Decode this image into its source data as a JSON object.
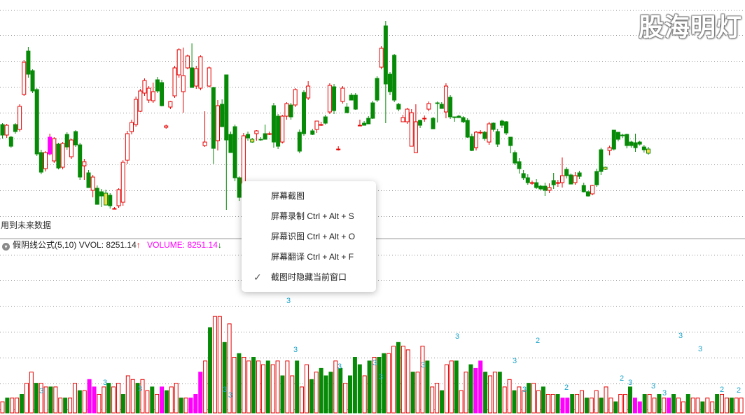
{
  "watermark": "股海明灯",
  "note": "用到未来数据",
  "indicator": {
    "title": "假阴线公式(5,10)",
    "vvol_label": "VVOL: ",
    "vvol_value": "8251.14",
    "vvol_arrow": "↑",
    "volume_label": "VOLUME: ",
    "volume_value": "8251.14",
    "volume_arrow": "↓"
  },
  "context_menu": {
    "items": [
      {
        "label": "屏幕截图",
        "checked": false
      },
      {
        "label": "屏幕录制 Ctrl + Alt + S",
        "checked": false
      },
      {
        "label": "屏幕识图 Ctrl + Alt + O",
        "checked": false
      },
      {
        "label": "屏幕翻译 Ctrl + Alt + F",
        "checked": false
      },
      {
        "label": "截图时隐藏当前窗口",
        "checked": true
      }
    ],
    "check_glyph": "✓"
  },
  "colors": {
    "rise": "#e60000",
    "fall": "#078a07",
    "special": "#ff00ff",
    "highlight": "#ffd54a",
    "volume_peak": "#ff0000",
    "grid": "#8a8a8a",
    "count_text": "#1aa3c9"
  },
  "chart_data": {
    "type": "candlestick-with-volume",
    "price_candles_ohlc": [
      [
        131,
        116,
        111,
        133
      ],
      [
        116,
        130,
        112,
        132
      ],
      [
        113,
        100,
        98,
        115
      ],
      [
        131,
        121,
        118,
        133
      ],
      [
        124,
        157,
        121,
        160
      ],
      [
        174,
        220,
        172,
        223
      ],
      [
        236,
        203,
        198,
        242
      ],
      [
        208,
        179,
        176,
        210
      ],
      [
        181,
        89,
        86,
        183
      ],
      [
        91,
        63,
        60,
        95
      ],
      [
        68,
        91,
        64,
        93
      ],
      [
        89,
        113,
        87,
        118
      ],
      [
        79,
        111,
        76,
        113
      ],
      [
        103,
        69,
        67,
        105
      ],
      [
        70,
        104,
        67,
        106
      ],
      [
        117,
        99,
        95,
        120
      ],
      [
        85,
        109,
        82,
        111
      ],
      [
        121,
        102,
        99,
        123
      ],
      [
        102,
        56,
        52,
        105
      ],
      [
        72,
        78,
        52,
        82
      ],
      [
        62,
        41,
        59,
        66
      ],
      [
        37,
        56,
        27,
        59
      ],
      [
        40,
        17,
        37,
        44
      ],
      [
        35,
        29,
        13,
        39
      ],
      [
        33,
        16,
        28,
        38
      ],
      [
        30,
        15,
        11,
        33
      ],
      [
        11,
        11,
        10,
        13
      ],
      [
        15,
        38,
        12,
        40
      ],
      [
        20,
        77,
        15,
        80
      ],
      [
        80,
        118,
        75,
        122
      ],
      [
        121,
        134,
        117,
        138
      ],
      [
        131,
        167,
        128,
        171
      ],
      [
        150,
        179,
        149,
        182
      ],
      [
        176,
        194,
        172,
        197
      ],
      [
        166,
        183,
        162,
        186
      ],
      [
        165,
        178,
        162,
        191
      ],
      [
        195,
        179,
        176,
        199
      ],
      [
        191,
        158,
        157,
        195
      ],
      [
        127,
        129,
        125,
        131
      ],
      [
        156,
        164,
        153,
        165
      ],
      [
        172,
        212,
        169,
        215
      ],
      [
        202,
        238,
        198,
        240
      ],
      [
        178,
        201,
        148,
        241
      ],
      [
        212,
        229,
        210,
        231
      ],
      [
        212,
        184,
        208,
        247
      ],
      [
        186,
        211,
        182,
        215
      ],
      [
        183,
        228,
        180,
        230
      ],
      [
        101,
        106,
        99,
        150
      ],
      [
        186,
        212,
        184,
        214
      ],
      [
        184,
        97,
        75,
        100
      ],
      [
        108,
        158,
        94,
        166
      ],
      [
        160,
        128,
        142,
        167
      ],
      [
        202,
        109,
        9,
        110
      ],
      [
        117,
        91,
        109,
        121
      ],
      [
        128,
        55,
        50,
        131
      ],
      [
        55,
        27,
        22,
        57
      ],
      [
        27,
        115,
        23,
        119
      ],
      [
        117,
        112,
        108,
        121
      ],
      [
        110,
        106,
        105,
        112
      ],
      [
        118,
        122,
        108,
        123
      ],
      [
        110,
        109,
        108,
        113
      ],
      [
        118,
        110,
        112,
        131
      ],
      [
        118,
        118,
        116,
        121
      ],
      [
        158,
        106,
        98,
        162
      ],
      [
        143,
        100,
        96,
        146
      ],
      [
        106,
        143,
        104,
        145
      ],
      [
        143,
        161,
        138,
        163
      ],
      [
        159,
        142,
        138,
        162
      ],
      [
        159,
        181,
        156,
        183
      ],
      [
        120,
        93,
        90,
        124
      ],
      [
        177,
        118,
        115,
        180
      ],
      [
        169,
        186,
        166,
        193
      ],
      [
        122,
        117,
        116,
        125
      ],
      [
        124,
        136,
        119,
        129
      ],
      [
        131,
        131,
        129,
        135
      ],
      [
        142,
        133,
        131,
        145
      ],
      [
        149,
        187,
        146,
        190
      ],
      [
        185,
        151,
        146,
        189
      ],
      [
        96,
        96,
        94,
        100
      ],
      [
        164,
        183,
        161,
        186
      ],
      [
        156,
        148,
        156,
        162
      ],
      [
        173,
        166,
        169,
        176
      ],
      [
        173,
        153,
        152,
        176
      ],
      [
        130,
        130,
        136,
        138
      ],
      [
        133,
        130,
        130,
        136
      ],
      [
        140,
        132,
        134,
        143
      ],
      [
        162,
        140,
        139,
        165
      ],
      [
        197,
        166,
        163,
        200
      ],
      [
        213,
        240,
        210,
        243
      ],
      [
        272,
        189,
        133,
        279
      ],
      [
        203,
        178,
        173,
        206
      ],
      [
        230,
        166,
        163,
        232
      ],
      [
        160,
        153,
        150,
        162
      ],
      [
        135,
        141,
        138,
        145
      ],
      [
        135,
        153,
        132,
        155
      ],
      [
        100,
        148,
        135,
        153
      ],
      [
        91,
        135,
        142,
        160
      ],
      [
        137,
        130,
        126,
        138
      ],
      [
        140,
        140,
        135,
        144
      ],
      [
        153,
        161,
        150,
        164
      ],
      [
        140,
        125,
        131,
        142
      ],
      [
        162,
        161,
        134,
        164
      ],
      [
        160,
        154,
        156,
        163
      ],
      [
        149,
        186,
        140,
        190
      ],
      [
        170,
        142,
        139,
        173
      ],
      [
        142,
        141,
        135,
        140
      ],
      [
        143,
        141,
        142,
        145
      ],
      [
        141,
        135,
        133,
        143
      ],
      [
        137,
        113,
        112,
        140
      ],
      [
        114,
        94,
        93,
        118
      ],
      [
        98,
        120,
        94,
        122
      ],
      [
        120,
        120,
        117,
        123
      ],
      [
        120,
        111,
        108,
        122
      ],
      [
        106,
        132,
        102,
        135
      ],
      [
        133,
        124,
        121,
        134
      ],
      [
        121,
        103,
        99,
        125
      ],
      [
        136,
        130,
        126,
        138
      ],
      [
        135,
        119,
        116,
        136
      ],
      [
        113,
        101,
        90,
        106
      ],
      [
        91,
        76,
        73,
        94
      ],
      [
        78,
        68,
        61,
        83
      ],
      [
        61,
        55,
        52,
        66
      ],
      [
        55,
        48,
        45,
        60
      ],
      [
        48,
        48,
        45,
        51
      ],
      [
        48,
        41,
        39,
        53
      ],
      [
        43,
        39,
        37,
        45
      ],
      [
        43,
        37,
        29,
        48
      ],
      [
        37,
        41,
        33,
        47
      ],
      [
        51,
        45,
        39,
        62
      ],
      [
        48,
        48,
        42,
        52
      ],
      [
        48,
        58,
        41,
        84
      ],
      [
        67,
        58,
        54,
        70
      ],
      [
        59,
        46,
        46,
        61
      ],
      [
        48,
        58,
        45,
        63
      ],
      [
        62,
        57,
        53,
        65
      ],
      [
        44,
        35,
        34,
        48
      ],
      [
        35,
        29,
        28,
        36
      ],
      [
        32,
        44,
        30,
        45
      ],
      [
        64,
        45,
        42,
        68
      ],
      [
        95,
        64,
        59,
        98
      ],
      [
        70,
        67,
        66,
        71
      ],
      [
        94,
        98,
        87,
        101
      ],
      [
        123,
        96,
        94,
        119
      ],
      [
        120,
        110,
        107,
        120
      ],
      [
        116,
        115,
        112,
        118
      ],
      [
        117,
        101,
        97,
        118
      ],
      [
        106,
        101,
        98,
        108
      ],
      [
        105,
        98,
        92,
        118
      ],
      [
        106,
        103,
        101,
        108
      ],
      [
        99,
        95,
        91,
        102
      ],
      [
        96,
        90,
        88,
        99
      ]
    ],
    "price_note": "OHLC values are in the chart's price units read from the gridlines (0 = lowest gridline); price axis labels are not visible in the screenshot.",
    "volume_bars": [
      3,
      4,
      4,
      4,
      5,
      8,
      11,
      8,
      8,
      7,
      7,
      7,
      4,
      4,
      4,
      8,
      6,
      6,
      9,
      7,
      5,
      7,
      8,
      7,
      8,
      5,
      10,
      9,
      8,
      9,
      6,
      7,
      5,
      7,
      6,
      7,
      8,
      4,
      4,
      4,
      5,
      11,
      14,
      23,
      26,
      26,
      19,
      24,
      15,
      16,
      15,
      14,
      15,
      14,
      13,
      14,
      13,
      14,
      10,
      14,
      10,
      14,
      7,
      13,
      9,
      11,
      12,
      10,
      11,
      14,
      12,
      8,
      10,
      15,
      13,
      10,
      14,
      15,
      15,
      16,
      16,
      18,
      19,
      18,
      17,
      11,
      11,
      18,
      14,
      7,
      8,
      6,
      13,
      14,
      14,
      6,
      11,
      13,
      12,
      14,
      11,
      10,
      11,
      11,
      7,
      9,
      6,
      7,
      6,
      8,
      8,
      6,
      7,
      5,
      5,
      5,
      4,
      4,
      5,
      5,
      6,
      4,
      4,
      6,
      4,
      7,
      4,
      3,
      5,
      5,
      7,
      4,
      3,
      5,
      5,
      4,
      5,
      4,
      4,
      5,
      4,
      3,
      5,
      4,
      4,
      3,
      4,
      3,
      5,
      5,
      4,
      4,
      4,
      4
    ],
    "volume_counts_shown": [
      "3",
      "3",
      "3",
      "3",
      "3",
      "3",
      "3",
      "3",
      "3",
      "3",
      "3",
      "3",
      "3",
      "2",
      "3",
      "2",
      "3",
      "3",
      "3",
      "3",
      "3",
      "2",
      "2",
      "2"
    ]
  }
}
